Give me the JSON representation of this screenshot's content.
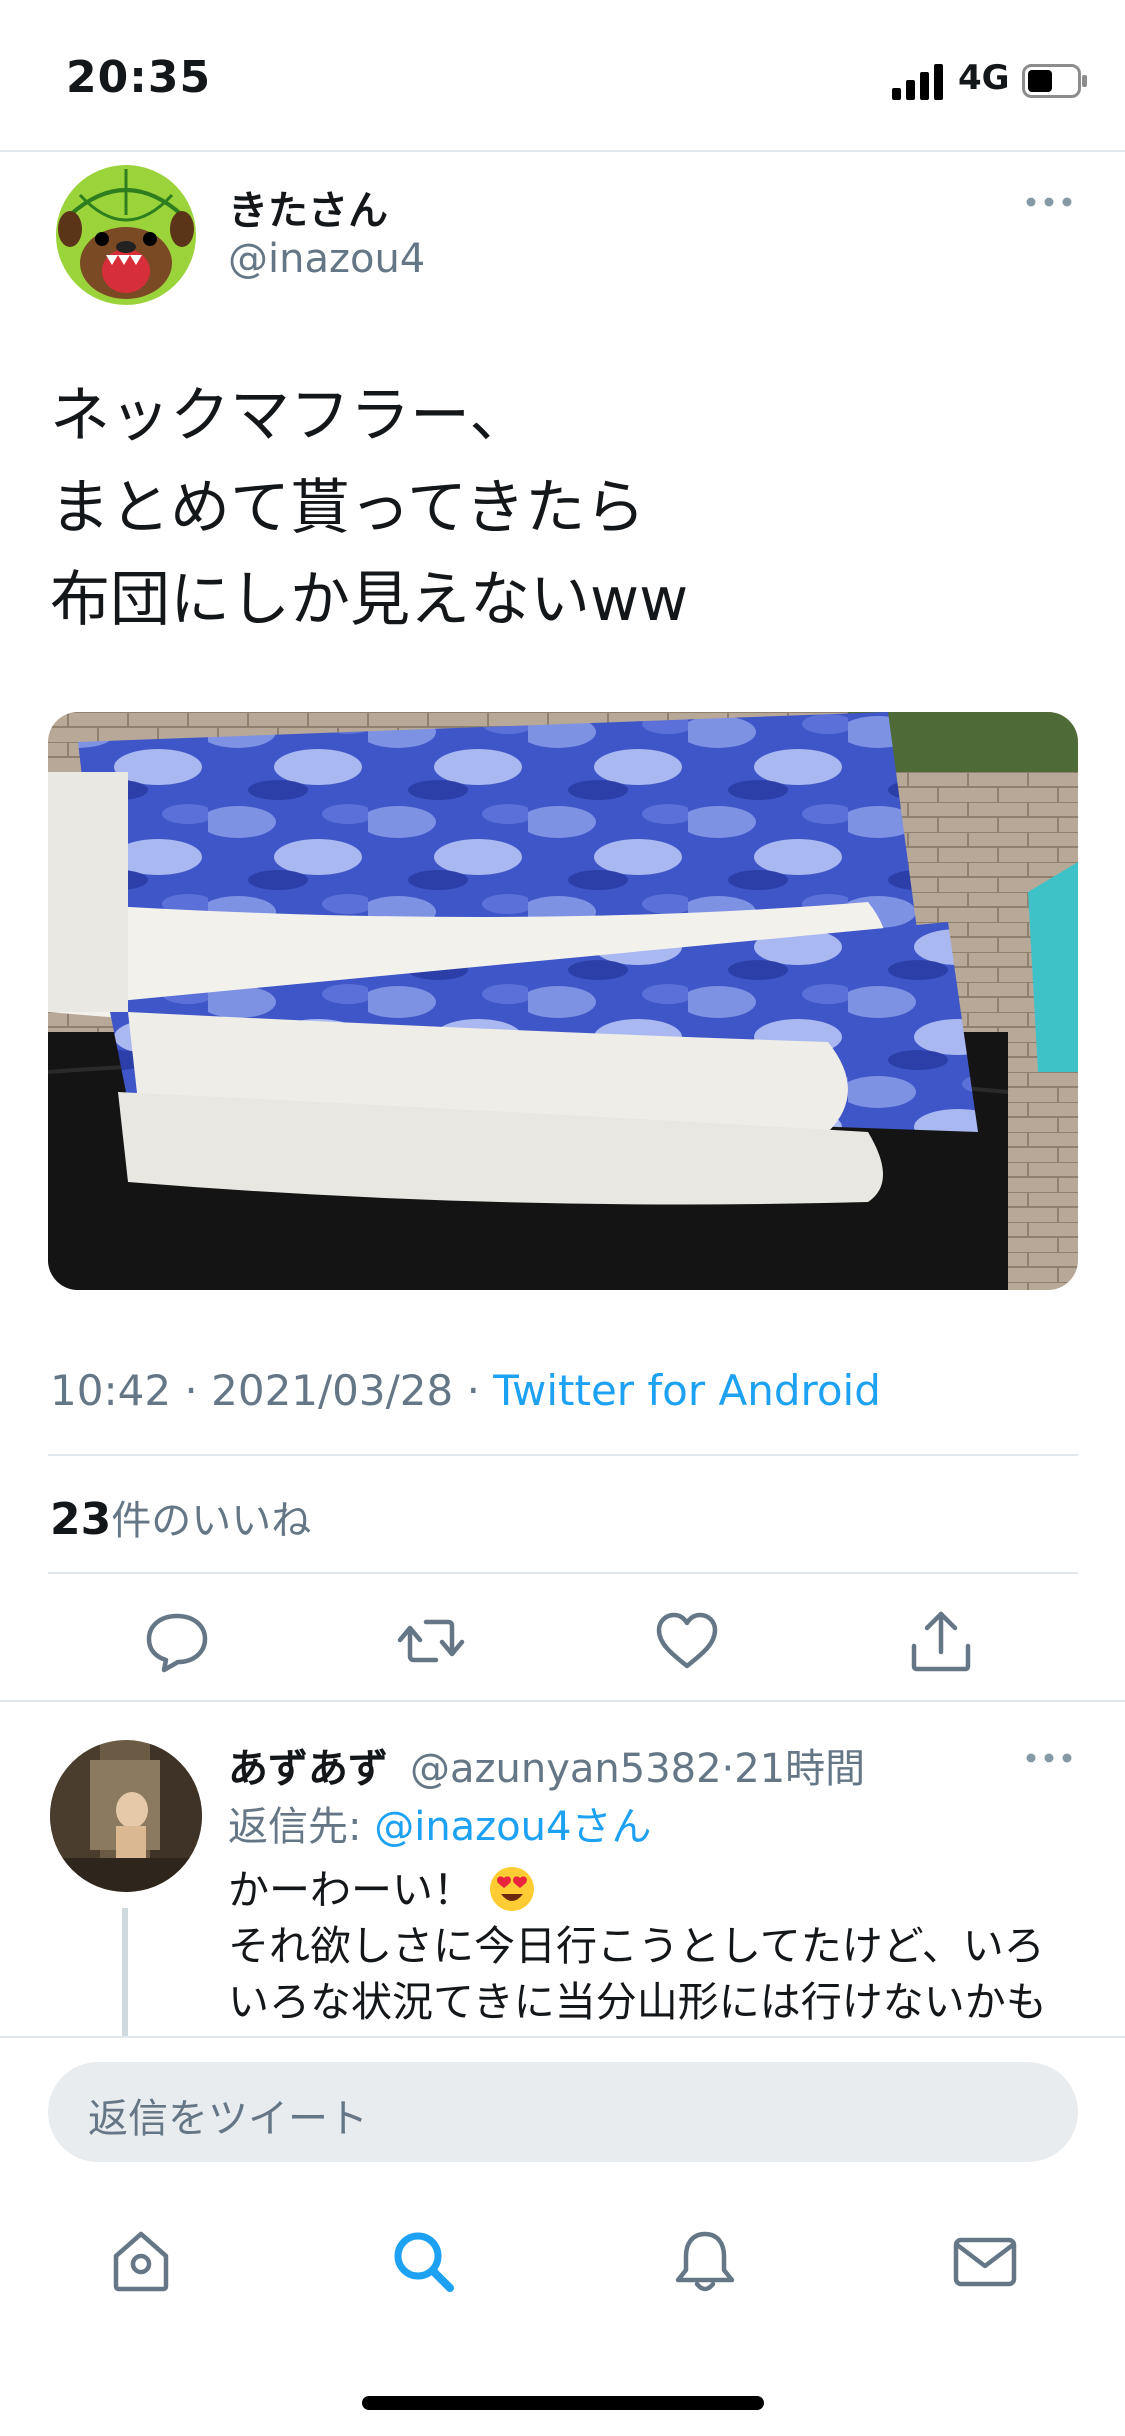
{
  "status_bar": {
    "time": "20:35",
    "network": "4G"
  },
  "tweet": {
    "display_name": "きたさん",
    "handle": "@inazou4",
    "text": "ネックマフラー、\nまとめて貰ってきたら\n布団にしか見えないww",
    "time": "10:42",
    "separator": "·",
    "date": "2021/03/28",
    "source": "Twitter for Android",
    "likes_count": "23",
    "likes_label": "件のいいね"
  },
  "reply": {
    "display_name": "あずあず",
    "handle": "@azunyan5382",
    "separator": "·",
    "time_ago": "21時間",
    "reply_to_prefix": "返信先: ",
    "reply_to_user": "@inazou4さん",
    "text_line1": "かーわーい！",
    "text_line2": "それ欲しさに今日行こうとしてたけど、いろいろな状況てきに当分山形には行けないかも"
  },
  "compose": {
    "placeholder": "返信をツイート"
  },
  "colors": {
    "accent": "#1da1f2",
    "secondary_text": "#657786",
    "divider": "#e1e8ed"
  }
}
